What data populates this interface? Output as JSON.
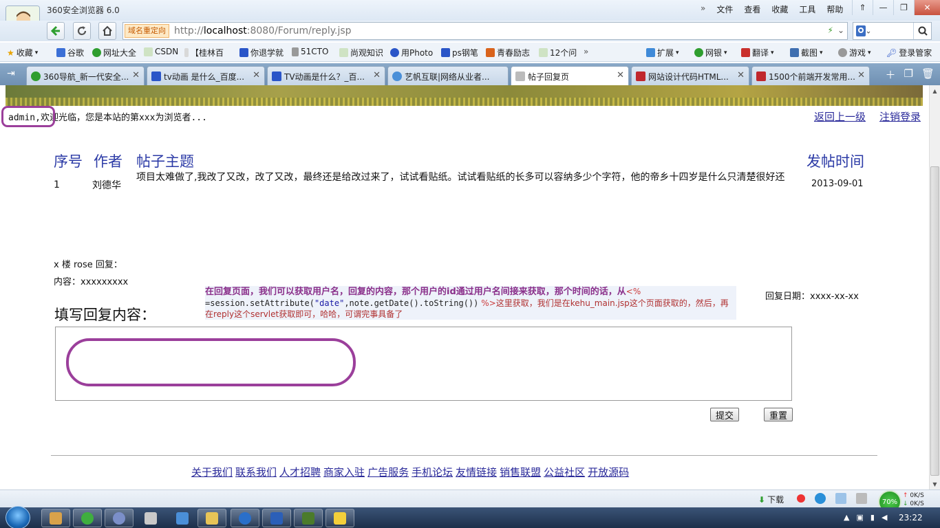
{
  "browser": {
    "title": "360安全浏览器 6.0",
    "menus": [
      "文件",
      "查看",
      "收藏",
      "工具",
      "帮助"
    ],
    "address": {
      "redirect_label": "域名重定向",
      "url_prefix": "http://",
      "url_host": "localhost",
      "url_rest": ":8080/Forum/reply.jsp"
    },
    "bookmarks": [
      "收藏",
      "谷歌",
      "网址大全",
      "CSDN",
      "【桂林百",
      "你退学就",
      "51CTO",
      "尚观知识",
      "用Photo",
      "ps钢笔",
      "青春励志",
      "12个问"
    ],
    "toolbar_right": [
      "扩展",
      "网银",
      "翻译",
      "截图",
      "游戏",
      "登录管家"
    ],
    "tabs": [
      {
        "label": "360导航_新一代安全...",
        "color": "#2f9e2f"
      },
      {
        "label": "tv动画 是什么_百度...",
        "color": "#2a55c8"
      },
      {
        "label": "TV动画是什么？_百...",
        "color": "#2a55c8"
      },
      {
        "label": "艺帆互联|网络从业者...",
        "color": "#4a8fd8"
      },
      {
        "label": "帖子回复页",
        "color": "#888888"
      },
      {
        "label": "网站设计代码HTML...",
        "color": "#c0272d"
      },
      {
        "label": "1500个前端开发常用...",
        "color": "#c0272d"
      }
    ],
    "status": {
      "download_label": "下载",
      "zoom": "70%",
      "up_speed": "0K/S",
      "down_speed": "0K/S"
    },
    "clock": "23:22"
  },
  "page": {
    "welcome": "admin,欢迎光临，您是本站的第xxx为浏览者...",
    "top_links": [
      "返回上一级",
      "注销登录"
    ],
    "table": {
      "headers": {
        "no": "序号",
        "author": "作者",
        "topic": "帖子主题",
        "time": "发帖时间"
      },
      "row": {
        "no": "1",
        "author": "刘德华",
        "topic": "项目太难做了,我改了又改，改了又改，最终还是给改过来了，试试看贴纸。试试看贴纸的长多可以容纳多少个字符，他的帝乡十四岁是什么只清楚很好还",
        "time": "2013-09-01"
      }
    },
    "reply": {
      "floor": "x 楼 rose 回复：",
      "content": "内容：xxxxxxxxx",
      "date": "回复日期：xxxx-xx-xx"
    },
    "note": {
      "line1": "在回复页面，我们可以获取用户名，回复的内容，那个用户的id通过用户名间接来获取，那个时间的话，从",
      "tag_open": "<%",
      "code_eq": "=session.setAttribute(",
      "code_str": "\"date\"",
      "code_rest": ",note.getDate().toString())",
      "tag_close": "%>",
      "line2": "这里获取，我们是在kehu_main.jsp这个页面获取的，然后，再在reply这个servlet获取即可，哈哈，可谓完事具备了"
    },
    "form": {
      "label": "填写回复内容：",
      "textarea_value": "",
      "submit": "提交",
      "reset": "重置"
    },
    "footer_links": [
      "关于我们",
      "联系我们",
      "人才招聘",
      "商家入驻",
      "广告服务",
      "手机论坛",
      "友情链接",
      "销售联盟",
      "公益社区",
      "开放源码"
    ]
  }
}
